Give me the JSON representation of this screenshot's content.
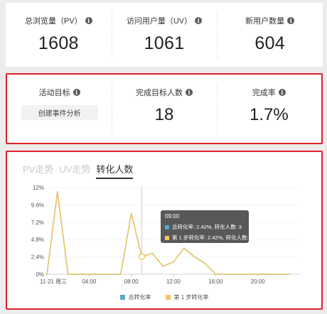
{
  "stats": [
    {
      "label": "总浏览量（PV）",
      "value": "1608"
    },
    {
      "label": "访问用户量（UV）",
      "value": "1061"
    },
    {
      "label": "新用户数量",
      "value": "604"
    }
  ],
  "goals": {
    "target_label": "活动目标",
    "target_button": "创建事件分析",
    "done_label": "完成目标人数",
    "done_value": "18",
    "rate_label": "完成率",
    "rate_value": "1.7%"
  },
  "info_glyph": "i",
  "tabs": [
    {
      "label": "PV走势",
      "active": false
    },
    {
      "label": "UV走势",
      "active": false
    },
    {
      "label": "转化人数",
      "active": true
    }
  ],
  "tooltip": {
    "time": "09:00",
    "rows": [
      {
        "text": "总转化率: 2.42%, 转化人数: 3",
        "color": "#5aa9c6"
      },
      {
        "text": "第 1 步转化率: 2.42%, 转化人数: 3",
        "color": "#f2c868"
      }
    ]
  },
  "legend": [
    {
      "label": "总转化率",
      "color": "#5aa9c6"
    },
    {
      "label": "第 1 步转化率",
      "color": "#f2c868"
    }
  ],
  "chart_data": {
    "type": "line",
    "x_tick_labels": [
      "11-21 周三",
      "04:00",
      "08:00",
      "12:00",
      "16:00",
      "20:00"
    ],
    "y_tick_labels": [
      "0%",
      "2.4%",
      "4.8%",
      "7.2%",
      "9.6%",
      "12%"
    ],
    "ylim": [
      0,
      12
    ],
    "x_hours": [
      0,
      1,
      2,
      3,
      4,
      5,
      6,
      7,
      8,
      9,
      10,
      11,
      12,
      13,
      14,
      15,
      16,
      17,
      18,
      19,
      20,
      21,
      22,
      23
    ],
    "series": [
      {
        "name": "第 1 步转化率",
        "color": "#f2c868",
        "values": [
          0,
          11.4,
          0,
          0,
          0,
          0,
          0,
          0,
          8.4,
          2.42,
          2.9,
          1.1,
          1.7,
          3.6,
          2.4,
          1.5,
          0,
          0,
          0,
          0,
          0,
          0,
          0,
          0
        ]
      },
      {
        "name": "总转化率",
        "color": "#5aa9c6",
        "values": [
          0,
          11.4,
          0,
          0,
          0,
          0,
          0,
          0,
          8.4,
          2.42,
          2.9,
          1.1,
          1.7,
          3.6,
          2.4,
          1.5,
          0,
          0,
          0,
          0,
          0,
          0,
          0,
          0
        ]
      }
    ],
    "highlight_index": 9,
    "grid": true
  }
}
